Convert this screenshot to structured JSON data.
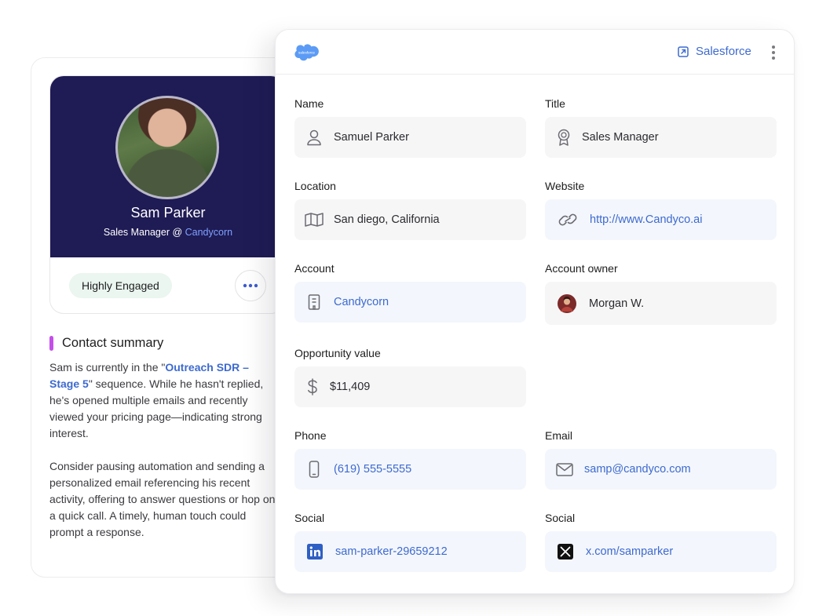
{
  "contact_card": {
    "name": "Sam Parker",
    "role": "Sales Manager @ ",
    "company": "Candycorn",
    "engagement_badge": "Highly Engaged",
    "more_icon": "ellipsis-icon",
    "summary": {
      "title": "Contact summary",
      "p1_before": "Sam is currently in the \"",
      "p1_link": "Outreach SDR – Stage 5",
      "p1_after": "\" sequence. While he hasn't replied, he's opened multiple emails and recently viewed your pricing page—indicating strong interest.",
      "p2": "Consider pausing automation and sending a personalized email referencing his recent activity, offering to answer questions or hop on a quick call. A timely, human touch could prompt a response."
    }
  },
  "panel": {
    "logo_text": "salesforce",
    "header_link": "Salesforce",
    "fields": {
      "name": {
        "label": "Name",
        "value": "Samuel Parker",
        "icon": "person-icon"
      },
      "title": {
        "label": "Title",
        "value": "Sales Manager",
        "icon": "badge-icon"
      },
      "location": {
        "label": "Location",
        "value": "San diego, California",
        "icon": "map-icon"
      },
      "website": {
        "label": "Website",
        "value": "http://www.Candyco.ai",
        "icon": "link-icon"
      },
      "account": {
        "label": "Account",
        "value": "Candycorn",
        "icon": "building-icon"
      },
      "account_owner": {
        "label": "Account owner",
        "value": "Morgan W.",
        "icon": "avatar"
      },
      "opportunity": {
        "label": "Opportunity value",
        "value": "$11,409",
        "icon": "dollar-icon"
      },
      "phone": {
        "label": "Phone",
        "value": "(619) 555-5555",
        "icon": "phone-icon"
      },
      "email": {
        "label": "Email",
        "value": "samp@candyco.com",
        "icon": "mail-icon"
      },
      "social_linkedin": {
        "label": "Social",
        "value": "sam-parker-29659212",
        "icon": "linkedin-icon"
      },
      "social_x": {
        "label": "Social",
        "value": "x.com/samparker",
        "icon": "x-icon"
      }
    }
  },
  "colors": {
    "hero_bg": "#1f1b55",
    "link_blue": "#3d6ad0",
    "accent_purple": "#c44fe8",
    "badge_green_bg": "#eaf6ef",
    "salesforce_blue": "#5b9bf5"
  }
}
